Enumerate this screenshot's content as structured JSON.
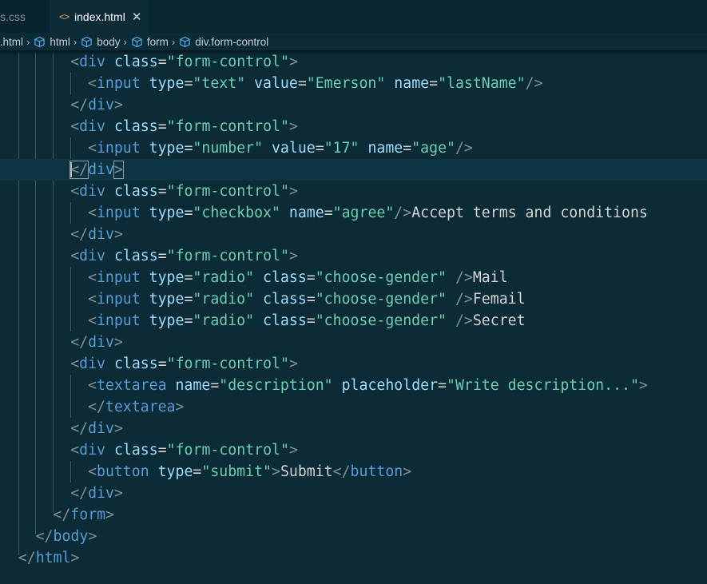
{
  "tabs": [
    {
      "label": "s.css",
      "active": false
    },
    {
      "label": "index.html",
      "active": true
    }
  ],
  "breadcrumb": [
    "x.html",
    "html",
    "body",
    "form",
    "div.form-control"
  ],
  "colors": {
    "background": "#0b2b36",
    "tag": "#569cd6",
    "attribute": "#9cdcfe",
    "string": "#6ccdb0",
    "text": "#d4d4d4",
    "punctuation": "#7f8f96"
  },
  "code_lines": [
    {
      "indent": 4,
      "tokens": [
        [
          "p",
          "<"
        ],
        [
          "t",
          "div"
        ],
        [
          "x",
          " "
        ],
        [
          "a",
          "class"
        ],
        [
          "x",
          "="
        ],
        [
          "s",
          "\"form-control\""
        ],
        [
          "p",
          ">"
        ]
      ]
    },
    {
      "indent": 5,
      "tokens": [
        [
          "p",
          "<"
        ],
        [
          "t",
          "input"
        ],
        [
          "x",
          " "
        ],
        [
          "a",
          "type"
        ],
        [
          "x",
          "="
        ],
        [
          "s",
          "\"text\""
        ],
        [
          "x",
          " "
        ],
        [
          "a",
          "value"
        ],
        [
          "x",
          "="
        ],
        [
          "s",
          "\"Emerson\""
        ],
        [
          "x",
          " "
        ],
        [
          "a",
          "name"
        ],
        [
          "x",
          "="
        ],
        [
          "s",
          "\"lastName\""
        ],
        [
          "p",
          "/>"
        ]
      ]
    },
    {
      "indent": 4,
      "tokens": [
        [
          "p",
          "</"
        ],
        [
          "t",
          "div"
        ],
        [
          "p",
          ">"
        ]
      ]
    },
    {
      "indent": 4,
      "tokens": [
        [
          "p",
          "<"
        ],
        [
          "t",
          "div"
        ],
        [
          "x",
          " "
        ],
        [
          "a",
          "class"
        ],
        [
          "x",
          "="
        ],
        [
          "s",
          "\"form-control\""
        ],
        [
          "p",
          ">"
        ]
      ]
    },
    {
      "indent": 5,
      "tokens": [
        [
          "p",
          "<"
        ],
        [
          "t",
          "input"
        ],
        [
          "x",
          " "
        ],
        [
          "a",
          "type"
        ],
        [
          "x",
          "="
        ],
        [
          "s",
          "\"number\""
        ],
        [
          "x",
          " "
        ],
        [
          "a",
          "value"
        ],
        [
          "x",
          "="
        ],
        [
          "s",
          "\"17\""
        ],
        [
          "x",
          " "
        ],
        [
          "a",
          "name"
        ],
        [
          "x",
          "="
        ],
        [
          "s",
          "\"age\""
        ],
        [
          "p",
          "/>"
        ]
      ]
    },
    {
      "indent": 4,
      "highlight": true,
      "tokens": [
        [
          "p",
          "</"
        ],
        [
          "t",
          "div"
        ],
        [
          "p",
          ">"
        ]
      ]
    },
    {
      "indent": 4,
      "tokens": [
        [
          "p",
          "<"
        ],
        [
          "t",
          "div"
        ],
        [
          "x",
          " "
        ],
        [
          "a",
          "class"
        ],
        [
          "x",
          "="
        ],
        [
          "s",
          "\"form-control\""
        ],
        [
          "p",
          ">"
        ]
      ]
    },
    {
      "indent": 5,
      "tokens": [
        [
          "p",
          "<"
        ],
        [
          "t",
          "input"
        ],
        [
          "x",
          " "
        ],
        [
          "a",
          "type"
        ],
        [
          "x",
          "="
        ],
        [
          "s",
          "\"checkbox\""
        ],
        [
          "x",
          " "
        ],
        [
          "a",
          "name"
        ],
        [
          "x",
          "="
        ],
        [
          "s",
          "\"agree\""
        ],
        [
          "p",
          "/>"
        ],
        [
          "x",
          "Accept terms and conditions"
        ]
      ]
    },
    {
      "indent": 4,
      "tokens": [
        [
          "p",
          "</"
        ],
        [
          "t",
          "div"
        ],
        [
          "p",
          ">"
        ]
      ]
    },
    {
      "indent": 4,
      "tokens": [
        [
          "p",
          "<"
        ],
        [
          "t",
          "div"
        ],
        [
          "x",
          " "
        ],
        [
          "a",
          "class"
        ],
        [
          "x",
          "="
        ],
        [
          "s",
          "\"form-control\""
        ],
        [
          "p",
          ">"
        ]
      ]
    },
    {
      "indent": 5,
      "tokens": [
        [
          "p",
          "<"
        ],
        [
          "t",
          "input"
        ],
        [
          "x",
          " "
        ],
        [
          "a",
          "type"
        ],
        [
          "x",
          "="
        ],
        [
          "s",
          "\"radio\""
        ],
        [
          "x",
          " "
        ],
        [
          "a",
          "class"
        ],
        [
          "x",
          "="
        ],
        [
          "s",
          "\"choose-gender\""
        ],
        [
          "x",
          " "
        ],
        [
          "p",
          "/>"
        ],
        [
          "x",
          "Mail"
        ]
      ]
    },
    {
      "indent": 5,
      "tokens": [
        [
          "p",
          "<"
        ],
        [
          "t",
          "input"
        ],
        [
          "x",
          " "
        ],
        [
          "a",
          "type"
        ],
        [
          "x",
          "="
        ],
        [
          "s",
          "\"radio\""
        ],
        [
          "x",
          " "
        ],
        [
          "a",
          "class"
        ],
        [
          "x",
          "="
        ],
        [
          "s",
          "\"choose-gender\""
        ],
        [
          "x",
          " "
        ],
        [
          "p",
          "/>"
        ],
        [
          "x",
          "Femail"
        ]
      ]
    },
    {
      "indent": 5,
      "tokens": [
        [
          "p",
          "<"
        ],
        [
          "t",
          "input"
        ],
        [
          "x",
          " "
        ],
        [
          "a",
          "type"
        ],
        [
          "x",
          "="
        ],
        [
          "s",
          "\"radio\""
        ],
        [
          "x",
          " "
        ],
        [
          "a",
          "class"
        ],
        [
          "x",
          "="
        ],
        [
          "s",
          "\"choose-gender\""
        ],
        [
          "x",
          " "
        ],
        [
          "p",
          "/>"
        ],
        [
          "x",
          "Secret"
        ]
      ]
    },
    {
      "indent": 4,
      "tokens": [
        [
          "p",
          "</"
        ],
        [
          "t",
          "div"
        ],
        [
          "p",
          ">"
        ]
      ]
    },
    {
      "indent": 4,
      "tokens": [
        [
          "p",
          "<"
        ],
        [
          "t",
          "div"
        ],
        [
          "x",
          " "
        ],
        [
          "a",
          "class"
        ],
        [
          "x",
          "="
        ],
        [
          "s",
          "\"form-control\""
        ],
        [
          "p",
          ">"
        ]
      ]
    },
    {
      "indent": 5,
      "tokens": [
        [
          "p",
          "<"
        ],
        [
          "t",
          "textarea"
        ],
        [
          "x",
          " "
        ],
        [
          "a",
          "name"
        ],
        [
          "x",
          "="
        ],
        [
          "s",
          "\"description\""
        ],
        [
          "x",
          " "
        ],
        [
          "a",
          "placeholder"
        ],
        [
          "x",
          "="
        ],
        [
          "s",
          "\"Write description...\""
        ],
        [
          "p",
          ">"
        ]
      ]
    },
    {
      "indent": 5,
      "tokens": [
        [
          "p",
          "</"
        ],
        [
          "t",
          "textarea"
        ],
        [
          "p",
          ">"
        ]
      ]
    },
    {
      "indent": 4,
      "tokens": [
        [
          "p",
          "</"
        ],
        [
          "t",
          "div"
        ],
        [
          "p",
          ">"
        ]
      ]
    },
    {
      "indent": 4,
      "tokens": [
        [
          "p",
          "<"
        ],
        [
          "t",
          "div"
        ],
        [
          "x",
          " "
        ],
        [
          "a",
          "class"
        ],
        [
          "x",
          "="
        ],
        [
          "s",
          "\"form-control\""
        ],
        [
          "p",
          ">"
        ]
      ]
    },
    {
      "indent": 5,
      "tokens": [
        [
          "p",
          "<"
        ],
        [
          "t",
          "button"
        ],
        [
          "x",
          " "
        ],
        [
          "a",
          "type"
        ],
        [
          "x",
          "="
        ],
        [
          "s",
          "\"submit\""
        ],
        [
          "p",
          ">"
        ],
        [
          "x",
          "Submit"
        ],
        [
          "p",
          "</"
        ],
        [
          "t",
          "button"
        ],
        [
          "p",
          ">"
        ]
      ]
    },
    {
      "indent": 4,
      "tokens": [
        [
          "p",
          "</"
        ],
        [
          "t",
          "div"
        ],
        [
          "p",
          ">"
        ]
      ]
    },
    {
      "indent": 3,
      "tokens": [
        [
          "p",
          "</"
        ],
        [
          "t",
          "form"
        ],
        [
          "p",
          ">"
        ]
      ]
    },
    {
      "indent": 2,
      "tokens": [
        [
          "p",
          "</"
        ],
        [
          "t",
          "body"
        ],
        [
          "p",
          ">"
        ]
      ]
    },
    {
      "indent": 1,
      "tokens": [
        [
          "p",
          "</"
        ],
        [
          "t",
          "html"
        ],
        [
          "p",
          ">"
        ]
      ]
    }
  ]
}
